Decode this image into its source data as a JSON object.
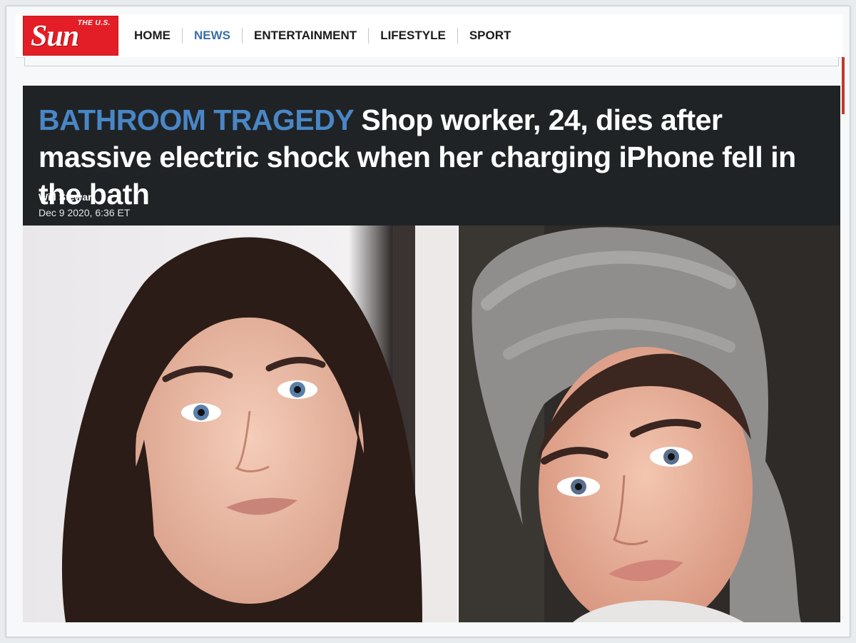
{
  "header": {
    "logo": {
      "small_text": "THE U.S.",
      "word": "Sun"
    },
    "nav": [
      {
        "label": "HOME",
        "active": false
      },
      {
        "label": "NEWS",
        "active": true
      },
      {
        "label": "ENTERTAINMENT",
        "active": false
      },
      {
        "label": "LIFESTYLE",
        "active": false
      },
      {
        "label": "SPORT",
        "active": false
      }
    ]
  },
  "article": {
    "kicker": "BATHROOM TRAGEDY",
    "headline": "Shop worker, 24, dies after massive electric shock when her charging iPhone fell in the bath",
    "author": "Will Stewart",
    "date": "Dec 9 2020, 6:36 ET"
  },
  "colors": {
    "brand_red": "#e41e26",
    "nav_active": "#3a6fa7",
    "kicker_blue": "#4a86c6",
    "headline_bg": "#1f2326"
  }
}
